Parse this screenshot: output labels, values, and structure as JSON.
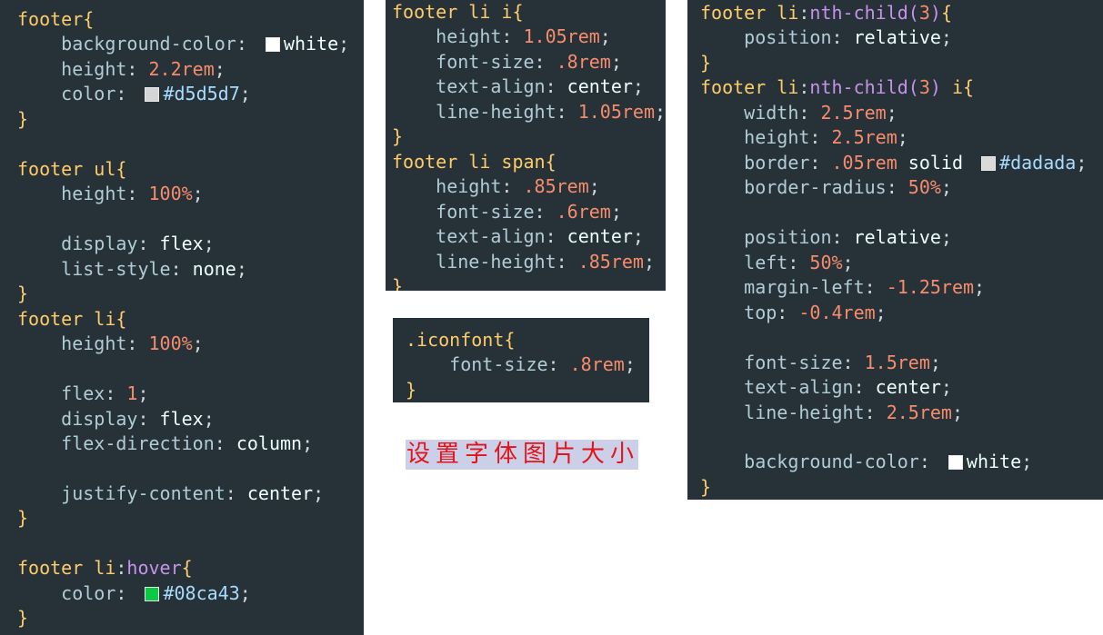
{
  "theme": {
    "background": "#263238",
    "selector": "#ffcb6b",
    "property": "#b2ccd6",
    "punctuation": "#cfd8dc",
    "keyword": "#eeffff",
    "number": "#f78c6c",
    "hex": "#a8dcff",
    "pseudo": "#c792ea"
  },
  "code_panels": [
    {
      "lines": [
        "footer{",
        "background-color: white;",
        "height: 2.2rem;",
        "color: #d5d5d7;",
        "}",
        "",
        "footer ul{",
        "height: 100%;",
        "",
        "display: flex;",
        "list-style: none;",
        "}",
        "footer li{",
        "height: 100%;",
        "",
        "flex: 1;",
        "display: flex;",
        "flex-direction: column;",
        "",
        "justify-content: center;",
        "}",
        "",
        "footer li:hover{",
        "color: #08ca43;",
        "}"
      ]
    },
    {
      "lines": [
        "footer li i{",
        "height: 1.05rem;",
        "font-size: .8rem;",
        "text-align: center;",
        "line-height: 1.05rem;",
        "}",
        "footer li span{",
        "height: .85rem;",
        "font-size: .6rem;",
        "text-align: center;",
        "line-height: .85rem;",
        "}"
      ]
    },
    {
      "lines": [
        ".iconfont{",
        "font-size: .8rem;",
        "}"
      ]
    },
    {
      "lines": [
        "footer li:nth-child(3){",
        "position: relative;",
        "}",
        "footer li:nth-child(3) i{",
        "width: 2.5rem;",
        "height: 2.5rem;",
        "border: .05rem solid #dadada;",
        "border-radius: 50%;",
        "",
        "position: relative;",
        "left: 50%;",
        "margin-left: -1.25rem;",
        "top: -0.4rem;",
        "",
        "font-size: 1.5rem;",
        "text-align: center;",
        "line-height: 2.5rem;",
        "",
        "background-color: white;",
        "}"
      ]
    }
  ],
  "note": {
    "text": "设置字体图片大小",
    "color": "#e4141b",
    "highlight": "#cbd0e8"
  }
}
